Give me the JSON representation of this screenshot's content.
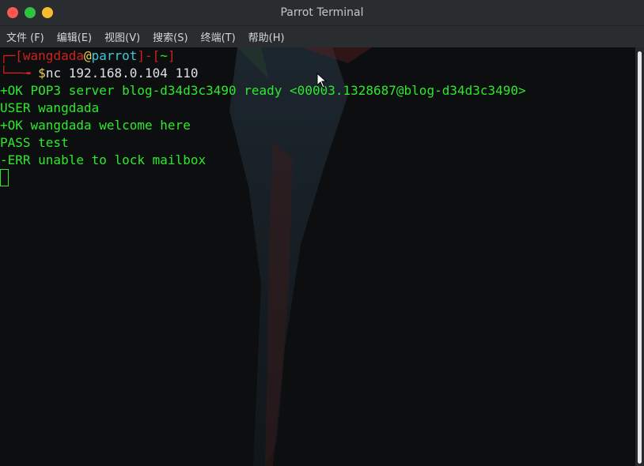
{
  "window": {
    "title": "Parrot Terminal"
  },
  "menu": [
    "文件 (F)",
    "编辑(E)",
    "视图(V)",
    "搜索(S)",
    "终端(T)",
    "帮助(H)"
  ],
  "prompt": {
    "open_bracket": "[",
    "user": "wangdada",
    "at": "@",
    "host": "parrot",
    "mid": "]-[",
    "dir": "~",
    "close_bracket": "]",
    "dollar": "$",
    "command": "nc 192.168.0.104 110"
  },
  "output": [
    "+OK POP3 server blog-d34d3c3490 ready <00003.1328687@blog-d34d3c3490>",
    "USER wangdada",
    "+OK wangdada welcome here",
    "PASS test",
    "-ERR unable to lock mailbox"
  ],
  "colors": {
    "text_green": "#2ee82e",
    "prompt_red": "#d02020",
    "host_cyan": "#3dc8d8",
    "dollar_yellow": "#f0d050"
  }
}
